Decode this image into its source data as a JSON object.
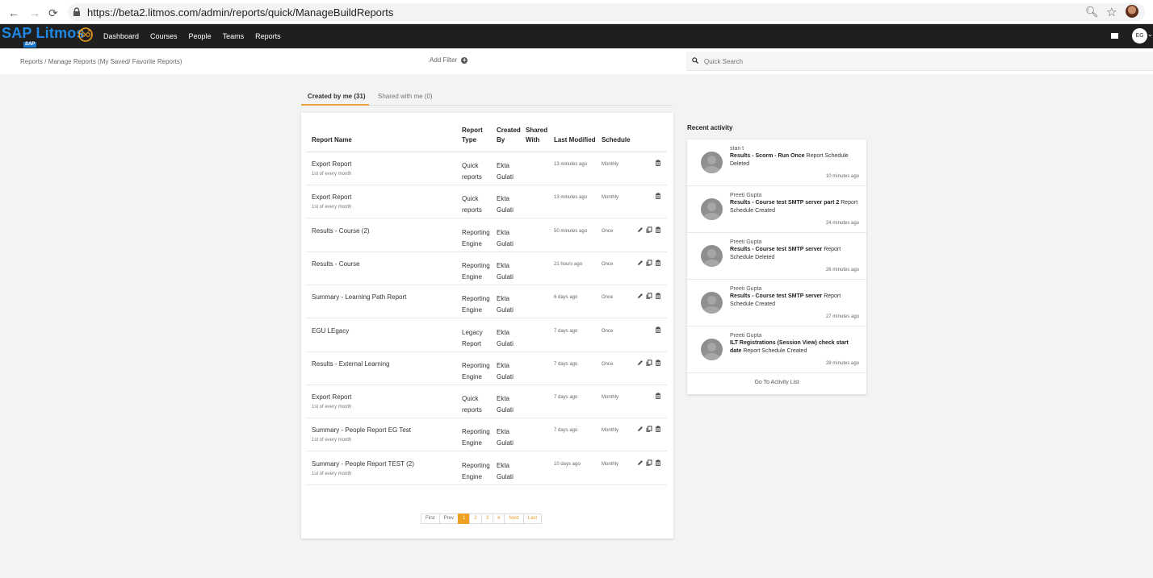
{
  "browser": {
    "url": "https://beta2.litmos.com/admin/reports/quick/ManageBuildReports"
  },
  "app": {
    "logo_text": "SAP Litmos",
    "sap_badge": "SAP",
    "nav": [
      "Dashboard",
      "Courses",
      "People",
      "Teams",
      "Reports"
    ],
    "user_initials": "EG"
  },
  "subheader": {
    "breadcrumb": "Reports  /  Manage Reports (My Saved/ Favorite Reports)",
    "add_filter": "Add Filter",
    "search_placeholder": "Quick Search"
  },
  "tabs": {
    "created": "Created by me (31)",
    "shared": "Shared with me (0)"
  },
  "table": {
    "headers": {
      "name": "Report Name",
      "type_1": "Report",
      "type_2": "Type",
      "created_1": "Created",
      "created_2": "By",
      "shared_1": "Shared",
      "shared_2": "With",
      "modified": "Last Modified",
      "schedule": "Schedule"
    },
    "rows": [
      {
        "name": "Export Report",
        "sub": "1st of every month",
        "type1": "Quick",
        "type2": "reports",
        "by1": "Ekta",
        "by2": "Gulati",
        "modified": "13 minutes ago",
        "schedule": "Monthly",
        "icons": "trash"
      },
      {
        "name": "Export Report",
        "sub": "1st of every month",
        "type1": "Quick",
        "type2": "reports",
        "by1": "Ekta",
        "by2": "Gulati",
        "modified": "13 minutes ago",
        "schedule": "Monthly",
        "icons": "trash"
      },
      {
        "name": "Results - Course (2)",
        "sub": "",
        "type1": "Reporting",
        "type2": "Engine",
        "by1": "Ekta",
        "by2": "Gulati",
        "modified": "50 minutes ago",
        "schedule": "Once",
        "icons": "all"
      },
      {
        "name": "Results - Course",
        "sub": "",
        "type1": "Reporting",
        "type2": "Engine",
        "by1": "Ekta",
        "by2": "Gulati",
        "modified": "21 hours ago",
        "schedule": "Once",
        "icons": "all"
      },
      {
        "name": "Summary - Learning Path Report",
        "sub": "",
        "type1": "Reporting",
        "type2": "Engine",
        "by1": "Ekta",
        "by2": "Gulati",
        "modified": "6 days ago",
        "schedule": "Once",
        "icons": "all"
      },
      {
        "name": "EGU LEgacy",
        "sub": "",
        "type1": "Legacy",
        "type2": "Report",
        "by1": "Ekta",
        "by2": "Gulati",
        "modified": "7 days ago",
        "schedule": "Once",
        "icons": "trash"
      },
      {
        "name": "Results - External Learning",
        "sub": "",
        "type1": "Reporting",
        "type2": "Engine",
        "by1": "Ekta",
        "by2": "Gulati",
        "modified": "7 days ago",
        "schedule": "Once",
        "icons": "all"
      },
      {
        "name": "Export Report",
        "sub": "1st of every month",
        "type1": "Quick",
        "type2": "reports",
        "by1": "Ekta",
        "by2": "Gulati",
        "modified": "7 days ago",
        "schedule": "Monthly",
        "icons": "trash"
      },
      {
        "name": "Summary - People Report EG Test",
        "sub": "1st of every month",
        "type1": "Reporting",
        "type2": "Engine",
        "by1": "Ekta",
        "by2": "Gulati",
        "modified": "7 days ago",
        "schedule": "Monthly",
        "icons": "all"
      },
      {
        "name": "Summary - People Report TEST (2)",
        "sub": "1st of every month",
        "type1": "Reporting",
        "type2": "Engine",
        "by1": "Ekta",
        "by2": "Gulati",
        "modified": "10 days ago",
        "schedule": "Monthly",
        "icons": "all"
      }
    ]
  },
  "pager": [
    "First",
    "Prev",
    "1",
    "2",
    "3",
    "4",
    "Next",
    "Last"
  ],
  "recent": {
    "title": "Recent activity",
    "items": [
      {
        "user": "stan t",
        "bold": "Results - Scorm - Run Once",
        "rest": " Report Schedule Deleted",
        "time": "10 minutes ago"
      },
      {
        "user": "Preeti Gupta",
        "bold": "Results - Course test SMTP server part 2",
        "rest": " Report Schedule Created",
        "time": "24 minutes ago"
      },
      {
        "user": "Preeti Gupta",
        "bold": "Results - Course test SMTP server",
        "rest": " Report Schedule Deleted",
        "time": "26 minutes ago"
      },
      {
        "user": "Preeti Gupta",
        "bold": "Results - Course test SMTP server",
        "rest": " Report Schedule Created",
        "time": "27 minutes ago"
      },
      {
        "user": "Preeti Gupta",
        "bold": "ILT Registrations (Session View) check start date",
        "rest": " Report Schedule Created",
        "time": "28 minutes ago"
      }
    ],
    "link": "Go To Activity List"
  }
}
